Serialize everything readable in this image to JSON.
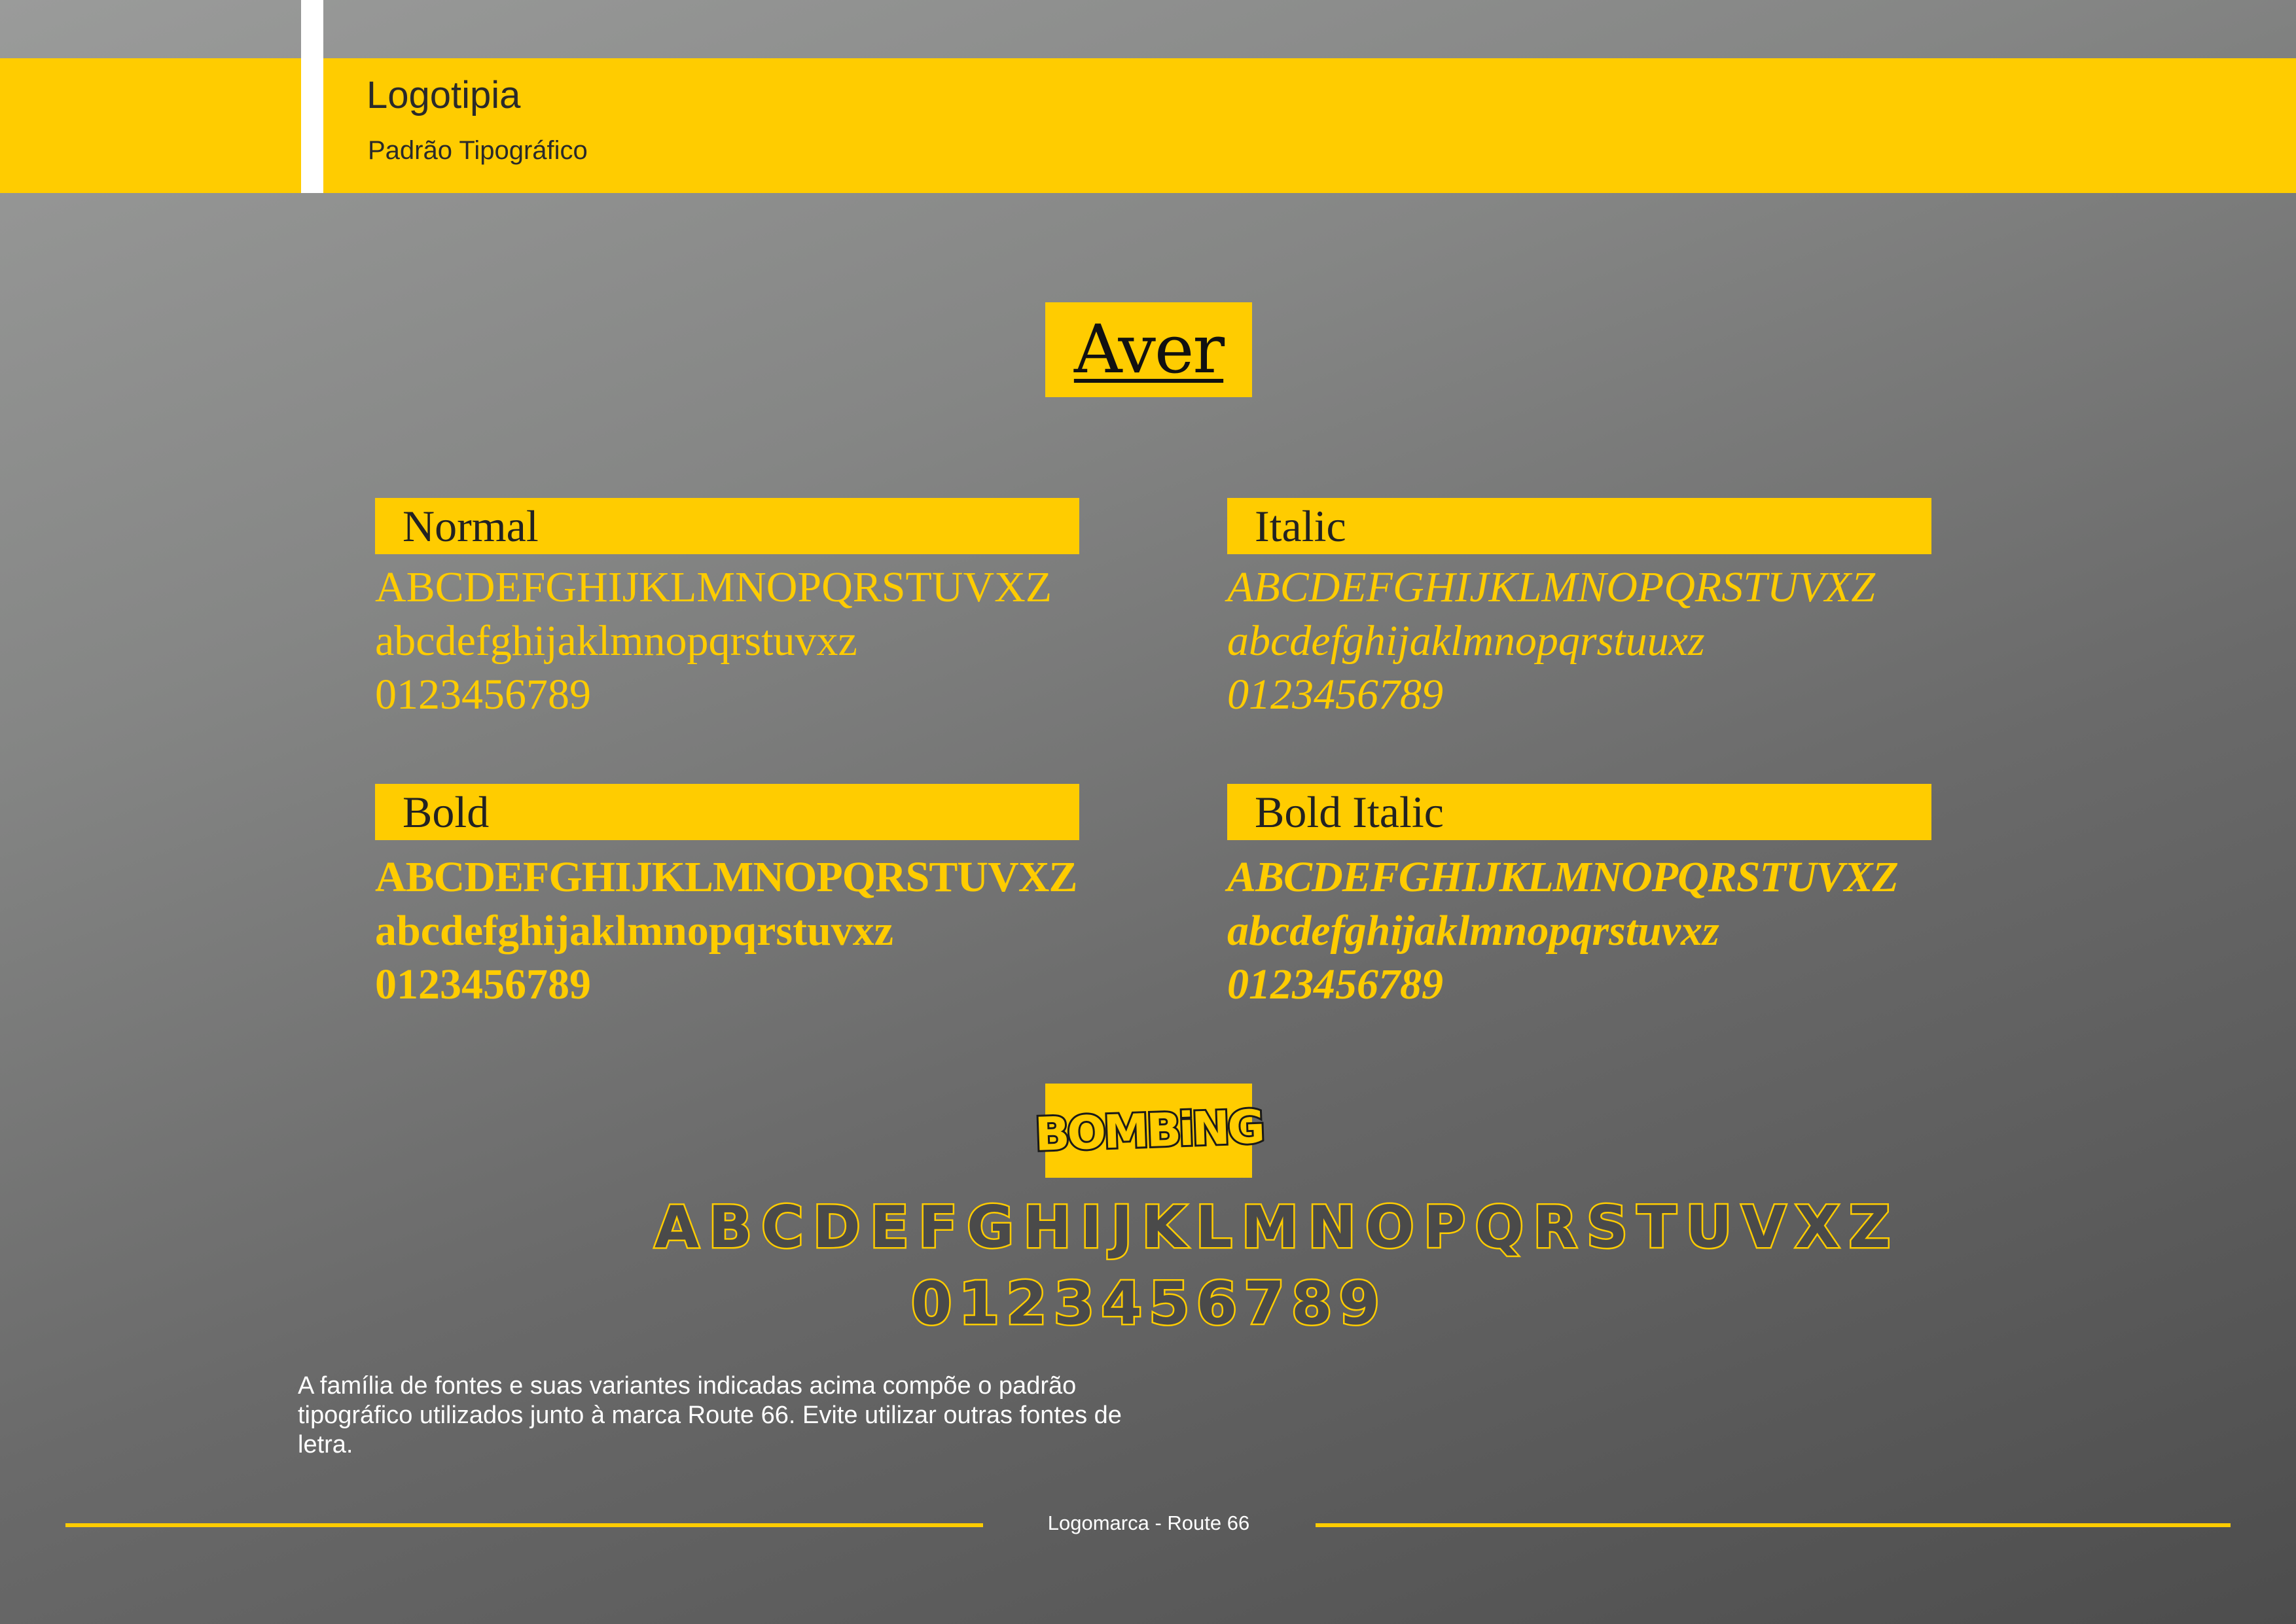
{
  "header": {
    "title": "Logotipia",
    "subtitle": "Padrão Tipográfico"
  },
  "colors": {
    "accent": "#ffcc00",
    "background_light": "#9a9b9a",
    "background_dark": "#4d4d4d",
    "stripe": "#ffffff"
  },
  "primary_font": {
    "name": "Aver",
    "variants": [
      {
        "label": "Normal",
        "uppercase": "ABCDEFGHIJKLMNOPQRSTUVXZ",
        "lowercase": "abcdefghijaklmnopqrstuvxz",
        "digits": "0123456789"
      },
      {
        "label": "Italic",
        "uppercase": "ABCDEFGHIJKLMNOPQRSTUVXZ",
        "lowercase": "abcdefghijaklmnopqrstuuxz",
        "digits": "0123456789"
      },
      {
        "label": "Bold",
        "uppercase": "ABCDEFGHIJKLMNOPQRSTUVXZ",
        "lowercase": "abcdefghijaklmnopqrstuvxz",
        "digits": "0123456789"
      },
      {
        "label": "Bold Italic",
        "uppercase": "ABCDEFGHIJKLMNOPQRSTUVXZ",
        "lowercase": "abcdefghijaklmnopqrstuvxz",
        "digits": "0123456789"
      }
    ]
  },
  "display_font": {
    "name": "BOMBiNG",
    "alphabet": "ABCDEFGHIJKLMNOPQRSTUVXZ",
    "digits": "0123456789"
  },
  "description": "A família de fontes e suas variantes indicadas acima compõe o padrão tipográfico utilizados junto à marca Route 66. Evite utilizar outras fontes de letra.",
  "footer": {
    "text": "Logomarca - Route 66"
  }
}
